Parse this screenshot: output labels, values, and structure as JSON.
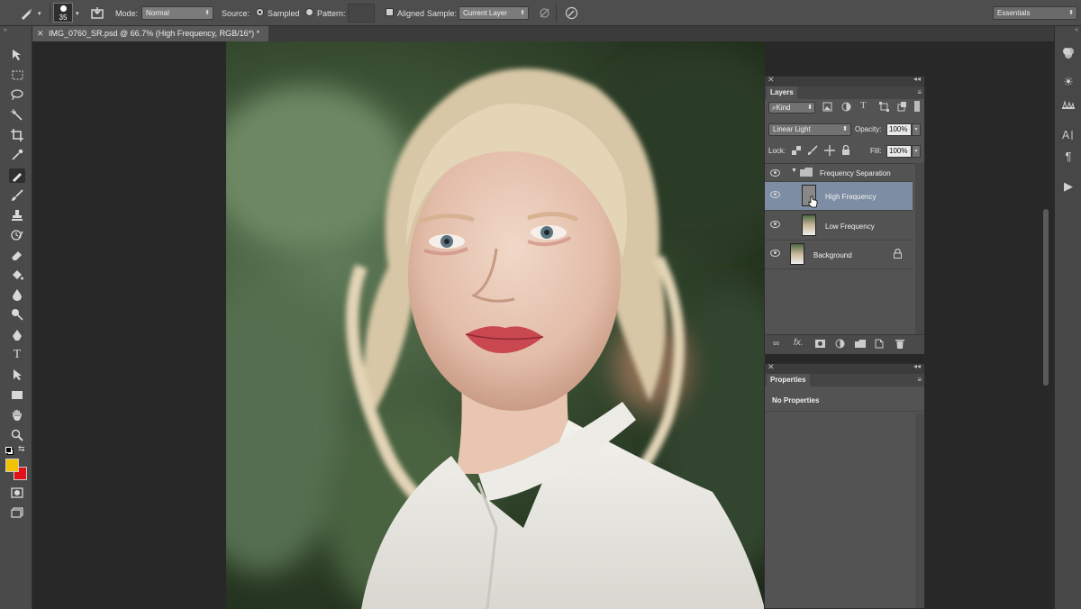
{
  "options_bar": {
    "brush_size": "35",
    "mode_label": "Mode:",
    "mode_value": "Normal",
    "source_label": "Source:",
    "sampled_label": "Sampled",
    "pattern_label": "Pattern:",
    "aligned_label": "Aligned",
    "sample_label": "Sample:",
    "sample_value": "Current Layer",
    "workspace": "Essentials"
  },
  "document": {
    "tab_title": "IMG_0760_SR.psd @ 66.7% (High Frequency, RGB/16*) *"
  },
  "layers_panel": {
    "title": "Layers",
    "filter_kind": "Kind",
    "blend_mode": "Linear Light",
    "opacity_label": "Opacity:",
    "opacity_value": "100%",
    "lock_label": "Lock:",
    "fill_label": "Fill:",
    "fill_value": "100%",
    "group_name": "Frequency Separation",
    "layers": [
      {
        "name": "High Frequency"
      },
      {
        "name": "Low Frequency"
      },
      {
        "name": "Background"
      }
    ]
  },
  "properties_panel": {
    "title": "Properties",
    "content": "No Properties"
  },
  "colors": {
    "foreground": "#f3c200",
    "background": "#e0121a",
    "active_layer": "#7d8ea4"
  }
}
